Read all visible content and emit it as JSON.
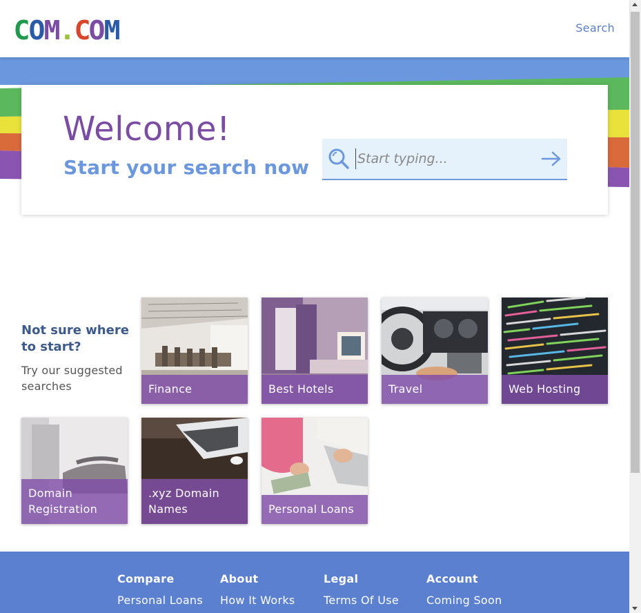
{
  "header": {
    "logo_letters": [
      {
        "char": "C",
        "color": "#1f9a4d"
      },
      {
        "char": "O",
        "color": "#2a5ba8"
      },
      {
        "char": "M",
        "color": "#7a4ca3"
      },
      {
        "char": ".",
        "color": "#9ac23c"
      },
      {
        "char": "C",
        "color": "#d9452b"
      },
      {
        "char": "O",
        "color": "#7a4ca3"
      },
      {
        "char": "M",
        "color": "#2a5ba8"
      }
    ],
    "search_link": "Search"
  },
  "hero": {
    "title": "Welcome!",
    "subtitle": "Start your search now",
    "search": {
      "placeholder": "Start typing...",
      "value": "",
      "icon": "search-icon",
      "submit_icon": "arrow-right-icon"
    },
    "stripe_colors": [
      "#6a97dd",
      "#5cb85c",
      "#e8e23a",
      "#d96a3a",
      "#8a55b0"
    ]
  },
  "suggestions": {
    "heading": "Not sure where to start?",
    "subheading": "Try our suggested searches",
    "tiles": [
      {
        "label": "Finance"
      },
      {
        "label": "Best Hotels"
      },
      {
        "label": "Travel"
      },
      {
        "label": "Web Hosting"
      },
      {
        "label": "Domain Registration"
      },
      {
        "label": ".xyz Domain Names"
      },
      {
        "label": "Personal Loans"
      }
    ]
  },
  "footer": {
    "columns": [
      {
        "heading": "Compare",
        "link": "Personal Loans"
      },
      {
        "heading": "About",
        "link": "How It Works"
      },
      {
        "heading": "Legal",
        "link": "Terms Of Use"
      },
      {
        "heading": "Account",
        "link": "Coming Soon"
      }
    ]
  },
  "colors": {
    "accent_purple": "#7a4ca3",
    "accent_blue": "#6a97dd",
    "footer_blue": "#5b80cf",
    "tile_overlay": "#804ea8"
  }
}
